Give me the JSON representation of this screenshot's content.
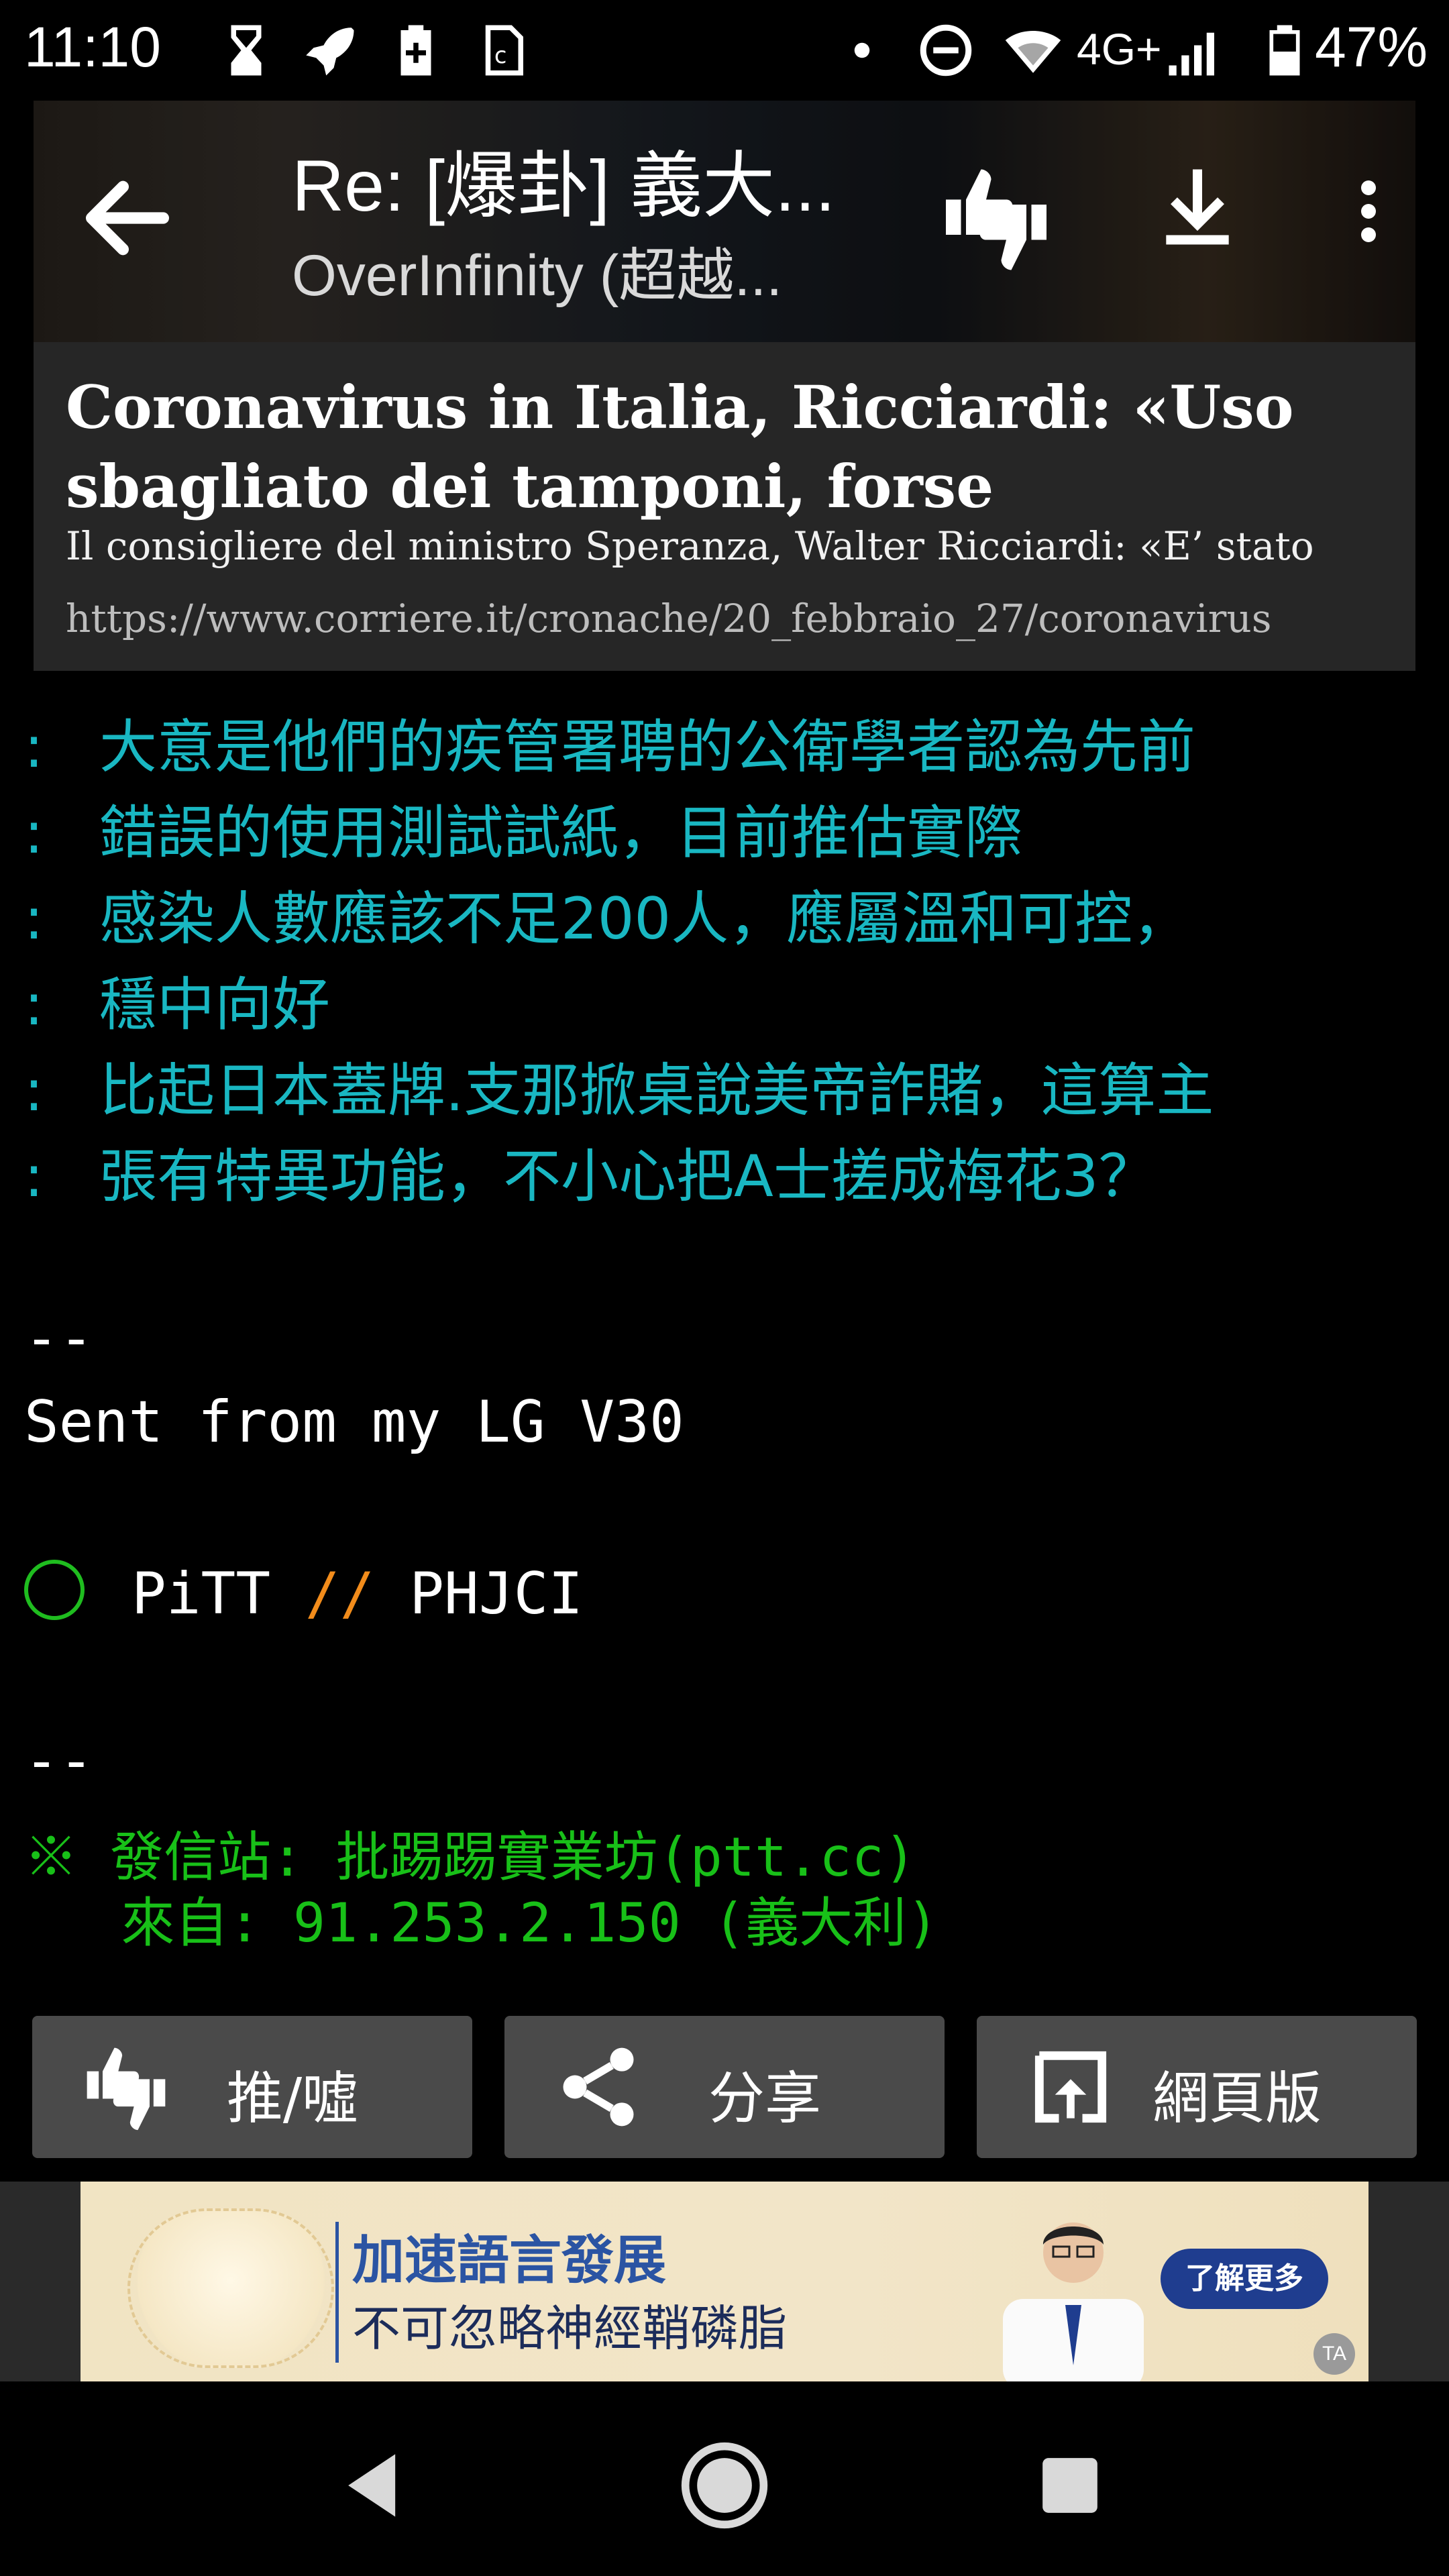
{
  "status_bar": {
    "time": "11:10",
    "network": "4G+",
    "battery": "47%"
  },
  "header": {
    "title": "Re: [爆卦] 義大...",
    "subtitle": "OverInfinity (超越..."
  },
  "link_card": {
    "title": "Coronavirus in Italia, Ricciardi: «Uso sbagliato dei tamponi, forse",
    "description": "Il consigliere del ministro Speranza, Walter Ricciardi: «E’ stato",
    "url": "https://www.corriere.it/cronache/20_febbraio_27/coronavirus"
  },
  "quote": {
    "marker": ":",
    "lines": [
      "大意是他們的疾管署聘的公衛學者認為先前",
      "錯誤的使用測試試紙，目前推估實際",
      "感染人數應該不足200人，應屬溫和可控，",
      "穩中向好",
      "比起日本蓋牌.支那掀桌說美帝詐賭，這算主",
      "張有特異功能，不小心把A士搓成梅花3？"
    ]
  },
  "signature": {
    "separator1": "--",
    "sent_from": "Sent from my LG V30",
    "pitt_left": "PiTT",
    "pitt_slashes": "//",
    "pitt_right": "PHJCI",
    "separator2": "--"
  },
  "footer": {
    "line1": "※ 發信站: 批踢踢實業坊(ptt.cc)",
    "line2": "   來自: 91.253.2.150 (義大利)"
  },
  "actions": {
    "push_label": "推/噓",
    "share_label": "分享",
    "web_label": "網頁版"
  },
  "ad": {
    "line1": "加速語言發展",
    "line2": "不可忽略神經鞘磷脂",
    "cta": "了解更多",
    "badge": "TA"
  },
  "colors": {
    "quote": "#19b7c2",
    "footer": "#18c018",
    "slashes": "#f28c1b",
    "button_bg": "#4a4a4a"
  }
}
